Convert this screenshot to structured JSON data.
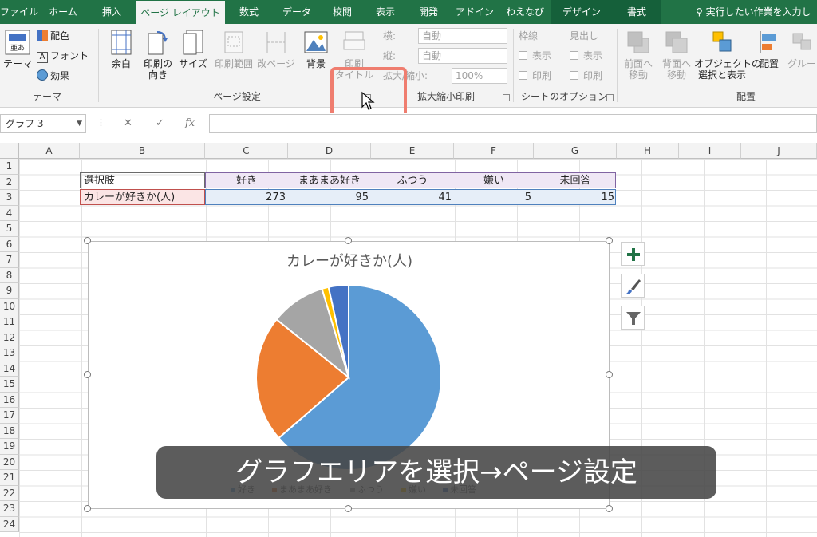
{
  "tabs": [
    {
      "label": "ファイル",
      "state": "normal"
    },
    {
      "label": "ホーム",
      "state": "normal"
    },
    {
      "label": "挿入",
      "state": "normal"
    },
    {
      "label": "ページ レイアウト",
      "state": "active"
    },
    {
      "label": "数式",
      "state": "normal"
    },
    {
      "label": "データ",
      "state": "normal"
    },
    {
      "label": "校閲",
      "state": "normal"
    },
    {
      "label": "表示",
      "state": "normal"
    },
    {
      "label": "開発",
      "state": "normal"
    },
    {
      "label": "アドイン",
      "state": "normal"
    },
    {
      "label": "わえなび",
      "state": "normal"
    },
    {
      "label": "デザイン",
      "state": "context"
    },
    {
      "label": "書式",
      "state": "context"
    }
  ],
  "tell_me": "実行したい作業を入力し",
  "ribbon": {
    "theme_group": {
      "label": "テーマ",
      "theme_button": "テーマ",
      "colors": "配色",
      "fonts": "フォント",
      "effects": "効果"
    },
    "page_setup_group": {
      "label": "ページ設定",
      "margins": "余白",
      "orientation_line1": "印刷の",
      "orientation_line2": "向き",
      "size": "サイズ",
      "print_area": "印刷範囲",
      "breaks": "改ページ",
      "background": "背景",
      "print_titles_line1": "印刷",
      "print_titles_line2": "タイトル"
    },
    "scale_group": {
      "label": "拡大縮小印刷",
      "width_label": "横:",
      "width_value": "自動",
      "height_label": "縦:",
      "height_value": "自動",
      "scale_label": "拡大/縮小:",
      "scale_value": "100%"
    },
    "sheet_options_group": {
      "label": "シートのオプション",
      "gridlines": "枠線",
      "headings": "見出し",
      "view": "表示",
      "print": "印刷"
    },
    "arrange_group": {
      "label": "配置",
      "bring_forward_line1": "前面へ",
      "bring_forward_line2": "移動",
      "send_backward_line1": "背面へ",
      "send_backward_line2": "移動",
      "selection_pane_line1": "オブジェクトの",
      "selection_pane_line2": "選択と表示",
      "align": "配置",
      "group": "グルー"
    }
  },
  "formula_bar": {
    "name_box": "グラフ 3",
    "cancel": "✕",
    "enter": "✓",
    "fx": "fx",
    "content": ""
  },
  "columns": [
    "A",
    "B",
    "C",
    "D",
    "E",
    "F",
    "G",
    "H",
    "I",
    "J"
  ],
  "rows": [
    "1",
    "2",
    "3",
    "4",
    "5",
    "6",
    "7",
    "8",
    "9",
    "10",
    "11",
    "12",
    "13",
    "14",
    "15",
    "16",
    "17",
    "18",
    "19",
    "20",
    "21",
    "22",
    "23",
    "24"
  ],
  "cells": {
    "b2": "選択肢",
    "b3": "カレーが好きか(人)",
    "headers": [
      "好き",
      "まあまあ好き",
      "ふつう",
      "嫌い",
      "未回答"
    ],
    "values": [
      "273",
      "95",
      "41",
      "5",
      "15"
    ]
  },
  "colors": {
    "accent": "#217346",
    "slice_colors": [
      "#5b9bd5",
      "#ed7d31",
      "#a5a5a5",
      "#ffc000",
      "#4472c4"
    ]
  },
  "chart_data": {
    "type": "pie",
    "title": "カレーが好きか(人)",
    "categories": [
      "好き",
      "まあまあ好き",
      "ふつう",
      "嫌い",
      "未回答"
    ],
    "values": [
      273,
      95,
      41,
      5,
      15
    ],
    "legend_position": "bottom"
  },
  "caption": "グラフエリアを選択→ページ設定"
}
